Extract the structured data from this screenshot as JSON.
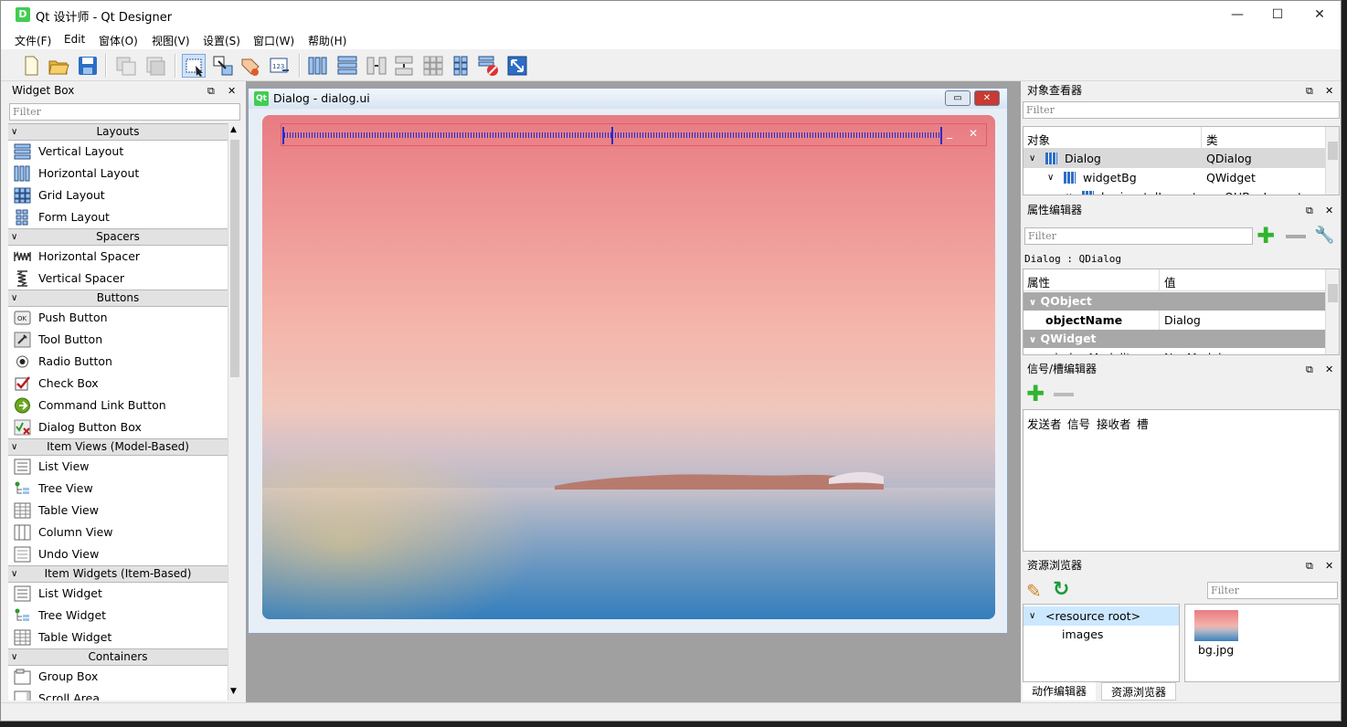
{
  "window": {
    "title": "Qt 设计师 - Qt Designer",
    "app_icon": "D",
    "minimize": "—",
    "maximize": "☐",
    "close": "✕"
  },
  "menubar": [
    "文件(F)",
    "Edit",
    "窗体(O)",
    "视图(V)",
    "设置(S)",
    "窗口(W)",
    "帮助(H)"
  ],
  "toolbar": {
    "icons": [
      "new-file-icon",
      "open-folder-icon",
      "save-icon",
      "copy-window-icon",
      "paste-window-icon",
      "edit-widgets-icon",
      "edit-signals-slots-icon",
      "edit-buddies-icon",
      "edit-tab-order-icon",
      "layout-horizontal-icon",
      "layout-vertical-icon",
      "layout-h-splitter-icon",
      "layout-v-splitter-icon",
      "layout-grid-icon",
      "layout-form-icon",
      "break-layout-icon",
      "adjust-size-icon"
    ]
  },
  "widget_box": {
    "title": "Widget Box",
    "filter_placeholder": "Filter",
    "categories": [
      {
        "name": "Layouts",
        "items": [
          "Vertical Layout",
          "Horizontal Layout",
          "Grid Layout",
          "Form Layout"
        ]
      },
      {
        "name": "Spacers",
        "items": [
          "Horizontal Spacer",
          "Vertical Spacer"
        ]
      },
      {
        "name": "Buttons",
        "items": [
          "Push Button",
          "Tool Button",
          "Radio Button",
          "Check Box",
          "Command Link Button",
          "Dialog Button Box"
        ]
      },
      {
        "name": "Item Views (Model-Based)",
        "items": [
          "List View",
          "Tree View",
          "Table View",
          "Column View",
          "Undo View"
        ]
      },
      {
        "name": "Item Widgets (Item-Based)",
        "items": [
          "List Widget",
          "Tree Widget",
          "Table Widget"
        ]
      },
      {
        "name": "Containers",
        "items": [
          "Group Box",
          "Scroll Area"
        ]
      }
    ]
  },
  "form": {
    "title": "Dialog - dialog.ui",
    "qt_badge": "Qt",
    "min": "▭",
    "close": "✕",
    "inner_min": "_",
    "inner_close": "✕"
  },
  "object_inspector": {
    "title": "对象查看器",
    "filter_placeholder": "Filter",
    "col_object": "对象",
    "col_class": "类",
    "rows": [
      {
        "name": "Dialog",
        "cls": "QDialog"
      },
      {
        "name": "widgetBg",
        "cls": "QWidget"
      },
      {
        "name": "horizontalLayout",
        "cls": "QHBoxLayout"
      }
    ]
  },
  "property_editor": {
    "title": "属性编辑器",
    "filter_placeholder": "Filter",
    "context": "Dialog : QDialog",
    "col_property": "属性",
    "col_value": "值",
    "group1": "QObject",
    "prop_name": "objectName",
    "prop_value": "Dialog",
    "group2": "QWidget",
    "cut_row_name": "windowModality",
    "cut_row_value": "NonModal"
  },
  "signal_slot": {
    "title": "信号/槽编辑器",
    "cols": [
      "发送者",
      "信号",
      "接收者",
      "槽"
    ]
  },
  "resource_browser": {
    "title": "资源浏览器",
    "filter_placeholder": "Filter",
    "root": "<resource root>",
    "child": "images",
    "file": "bg.jpg"
  },
  "bottom_tabs": [
    "动作编辑器",
    "资源浏览器"
  ],
  "colors": {
    "accent": "#41cd52",
    "selection": "#cce8ff",
    "layout_red": "#e05a6a"
  }
}
